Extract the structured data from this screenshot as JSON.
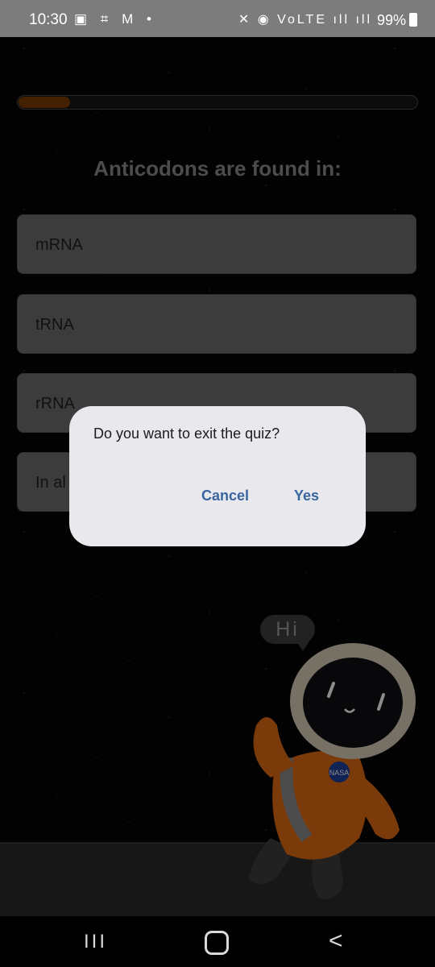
{
  "status_bar": {
    "time": "10:30",
    "left_icons": "▣ ⌗ M •",
    "right_icons": "✕ ◉ VoLTE ıll ıll",
    "battery": "99%"
  },
  "progress": {
    "fraction": 0.13,
    "color": "#7a3b00"
  },
  "quiz": {
    "question": "Anticodons are found in:",
    "options": [
      "mRNA",
      "tRNA",
      "rRNA",
      "In al"
    ]
  },
  "dialog": {
    "message": "Do you want to exit the quiz?",
    "cancel_label": "Cancel",
    "yes_label": "Yes"
  },
  "mascot": {
    "bubble_text": "Hi",
    "badge_text": "NASA"
  },
  "nav": {
    "recents_glyph": "III",
    "back_glyph": "<"
  }
}
